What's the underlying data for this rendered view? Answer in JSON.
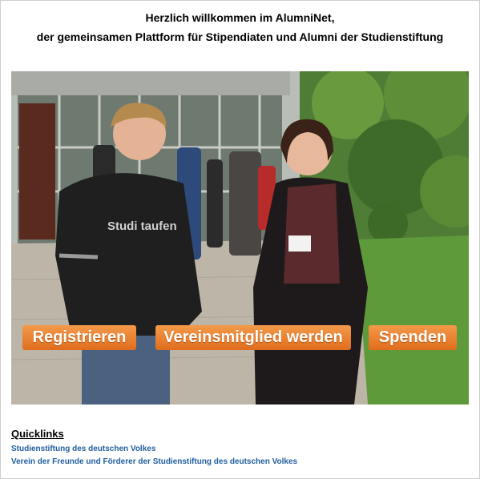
{
  "header": {
    "line1": "Herzlich willkommen im AlumniNet,",
    "line2": "der gemeinsamen Plattform für Stipendiaten und Alumni der Studienstiftung"
  },
  "hero": {
    "shirt_text": "Studi taufen",
    "buttons": {
      "register": "Registrieren",
      "member": "Vereinsmitglied werden",
      "donate": "Spenden"
    },
    "colors": {
      "button": "#e87a2a",
      "button_text": "#ffffff"
    }
  },
  "quicklinks": {
    "title": "Quicklinks",
    "links": [
      "Studienstiftung des deutschen Volkes",
      "Verein der Freunde und Förderer der Studienstiftung des deutschen Volkes"
    ],
    "link_color": "#1f5e9e"
  }
}
